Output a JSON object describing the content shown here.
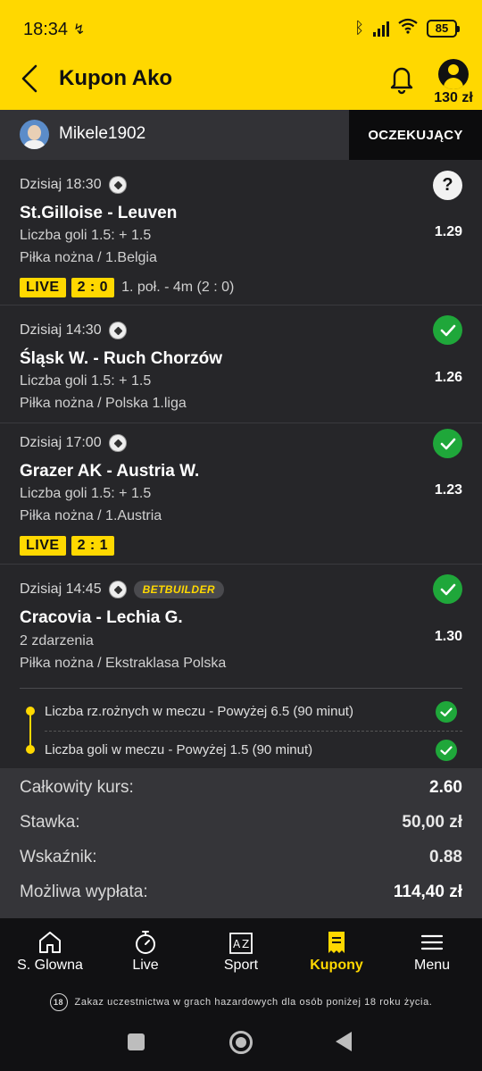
{
  "status_bar": {
    "time": "18:34",
    "battery": "85"
  },
  "header": {
    "title": "Kupon Ako",
    "balance": "130 zł"
  },
  "user": {
    "name": "Mikele1902",
    "status": "OCZEKUJĄCY"
  },
  "bets": [
    {
      "when": "Dzisiaj 18:30",
      "match": "St.Gilloise - Leuven",
      "market": "Liczba goli 1.5: + 1.5",
      "league": "Piłka nożna / 1.Belgia",
      "odds": "1.29",
      "result": "unknown",
      "result_symbol": "?",
      "live_label": "LIVE",
      "score": "2 : 0",
      "live_info": "1. poł. - 4m (2 : 0)"
    },
    {
      "when": "Dzisiaj 14:30",
      "match": "Śląsk W. - Ruch Chorzów",
      "market": "Liczba goli 1.5: + 1.5",
      "league": "Piłka nożna / Polska 1.liga",
      "odds": "1.26",
      "result": "won"
    },
    {
      "when": "Dzisiaj 17:00",
      "match": "Grazer AK - Austria W.",
      "market": "Liczba goli 1.5: + 1.5",
      "league": "Piłka nożna / 1.Austria",
      "odds": "1.23",
      "result": "won",
      "live_label": "LIVE",
      "score": "2 : 1"
    },
    {
      "when": "Dzisiaj 14:45",
      "badge": "BETBUILDER",
      "match": "Cracovia - Lechia G.",
      "market": "2 zdarzenia",
      "league": "Piłka nożna / Ekstraklasa Polska",
      "odds": "1.30",
      "result": "won",
      "selections": [
        "Liczba rz.rożnych w meczu - Powyżej 6.5 (90 minut)",
        "Liczba goli w meczu - Powyżej 1.5 (90 minut)"
      ]
    }
  ],
  "summary": {
    "total_odds_label": "Całkowity kurs:",
    "total_odds": "2.60",
    "stake_label": "Stawka:",
    "stake": "50,00 zł",
    "indicator_label": "Wskaźnik:",
    "indicator": "0.88",
    "payout_label": "Możliwa wypłata:",
    "payout": "114,40 zł"
  },
  "nav": [
    "S. Glowna",
    "Live",
    "Sport",
    "Kupony",
    "Menu"
  ],
  "nav_active": "Kupony",
  "disclaimer": {
    "age": "18",
    "text": "Zakaz uczestnictwa w grach hazardowych dla osób poniżej 18 roku życia."
  },
  "colors": {
    "brand_yellow": "#ffd800",
    "success_green": "#1fa73a",
    "background": "#262629"
  },
  "icons": [
    "back-icon",
    "bell-icon",
    "account-icon",
    "football-icon",
    "check-icon",
    "question-icon",
    "home-icon",
    "stopwatch-icon",
    "az-icon",
    "coupon-icon",
    "menu-icon"
  ]
}
